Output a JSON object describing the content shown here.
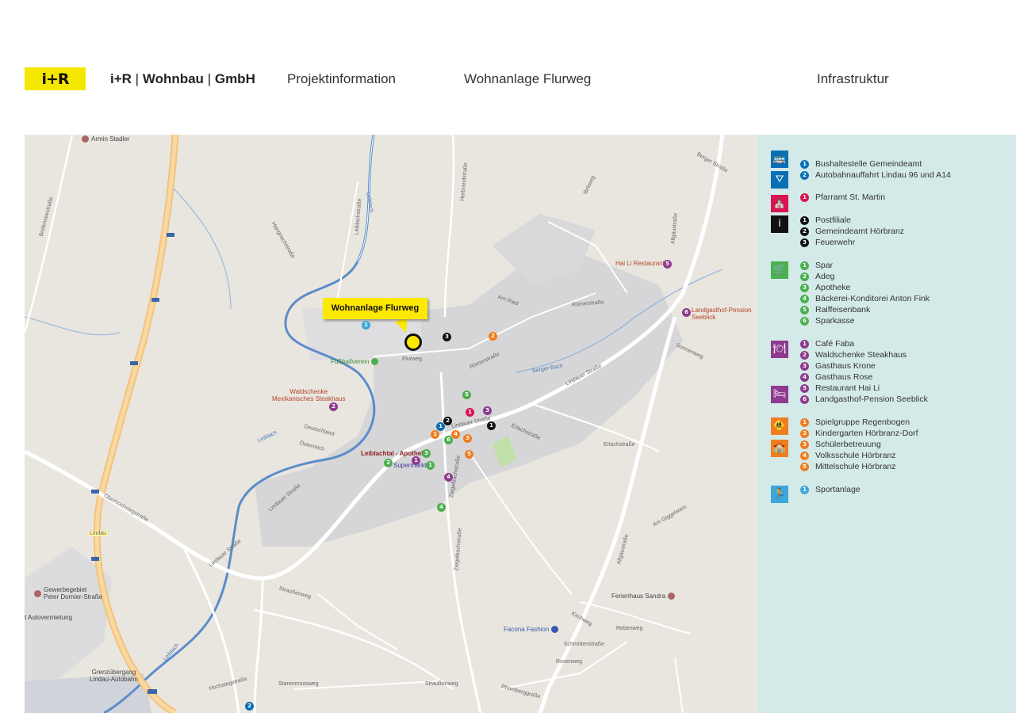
{
  "header": {
    "logo": "i+R",
    "company_name": "i+R",
    "company_wohnbau": "Wohnbau",
    "company_gmbh": "GmbH",
    "sep": "|",
    "projekt": "Projektinformation",
    "wohnanlage": "Wohnanlage Flurweg",
    "infrastruktur": "Infrastruktur"
  },
  "map": {
    "project_label": "Wohnanlage Flurweg",
    "places": {
      "armin_stadler": "Armin Stadler",
      "hai_li": "Hai Li Restaurant",
      "seeblick_1": "Landgasthof-Pension",
      "seeblick_2": "Seeblick",
      "fussballverein": "Fußballverein",
      "waldschenke_1": "Waldschenke",
      "waldschenke_2": "Mexikanisches Steakhaus",
      "apotheke": "Leiblachtal - Apotheke",
      "supermarkt": "Supermarkt",
      "gewerbe_1": "Gewerbegebiet",
      "gewerbe_2": "Peter Dornier-Straße",
      "autovermietung": "t Autovermietung",
      "grenz_1": "Grenzübergang",
      "grenz_2": "Lindau-Autobahn",
      "ferienhaus": "Ferienhaus Sandra",
      "facona": "Facona Fashion"
    },
    "streets": {
      "flurweg": "Flurweg",
      "roemerstr": "Römerstraße",
      "roemerstr2": "Römerstraße",
      "lindauer": "Lindauer Straße",
      "lindauer2": "Lindauer Straße",
      "lindauer3": "Lindauer Straße",
      "lindauer4": "Lindauer Straße",
      "berger_bach": "Berger Bach",
      "berger_str": "Berger Straße",
      "allgaeu": "Allgäustraße",
      "allgaeu2": "Allgäustraße",
      "strassenweg": "Straußenweg",
      "strassenweg2": "Straußenweg",
      "starenmoos": "Starenmoosweg",
      "hochsteg": "Hochstegstraße",
      "oberhochsteg": "Oberhochstegstraße",
      "leiblach": "Leiblach",
      "leiblach2": "Leiblach",
      "leiblach3": "Leiblach",
      "kirchweg": "Kirchweg",
      "rebenweg": "Rebenweg",
      "erlachstr": "Erlachstraße",
      "erlachstr2": "Erlachstraße",
      "sonnenweg": "Sonnenweg",
      "ziegelbach": "Ziegelbachstraße",
      "ziegelbach2": "Ziegelbachstraße",
      "herbrand": "Herbrandstraße",
      "bodensee": "Bodenseestraße",
      "hangnach": "Hangnachstraße",
      "am_ried": "Am Ried",
      "schmittenstr": "Schmittenstraße",
      "rosenweg": "Rosenweg",
      "birkweg": "Birkweg",
      "deutschland": "Deutschland",
      "oesterreich": "Österreich",
      "lindau": "Lindau",
      "am_giggelstein": "Am Giggelstein",
      "leiblachstr": "Leiblachstraße",
      "rheinberg": "Rhomberggraße"
    }
  },
  "legend": {
    "groups": [
      {
        "icon": "bus-icon",
        "color": "#0a6eb4",
        "glyph": "🚌",
        "items": []
      },
      {
        "icon": "highway-icon",
        "color": "#0a6eb4",
        "glyph": "⛛",
        "items": []
      },
      {
        "icon": "church-icon",
        "color": "#d9144f",
        "glyph": "⛪",
        "items": []
      },
      {
        "icon": "info-icon",
        "color": "#111111",
        "glyph": "i",
        "items": []
      },
      {
        "icon": "cart-icon",
        "color": "#4caf50",
        "glyph": "🛒",
        "items": []
      },
      {
        "icon": "restaurant-icon",
        "color": "#8e3a8e",
        "glyph": "🍽",
        "items": []
      },
      {
        "icon": "bed-icon",
        "color": "#8e3a8e",
        "glyph": "🛏",
        "items": []
      },
      {
        "icon": "child-icon",
        "color": "#ef7d20",
        "glyph": "🚸",
        "items": []
      },
      {
        "icon": "school-icon",
        "color": "#ef7d20",
        "glyph": "🏫",
        "items": []
      },
      {
        "icon": "sport-icon",
        "color": "#3ea6d9",
        "glyph": "🏃",
        "items": []
      }
    ],
    "items": [
      {
        "n": "1",
        "color": "#0a6eb4",
        "label": "Bushaltestelle Gemeindeamt"
      },
      {
        "n": "2",
        "color": "#0a6eb4",
        "label": "Autobahnauffahrt Lindau 96 und A14"
      },
      {
        "n": "1",
        "color": "#d9144f",
        "label": "Pfarramt St. Martin"
      },
      {
        "n": "1",
        "color": "#111111",
        "label": "Postfiliale"
      },
      {
        "n": "2",
        "color": "#111111",
        "label": "Gemeindeamt Hörbranz"
      },
      {
        "n": "3",
        "color": "#111111",
        "label": "Feuerwehr"
      },
      {
        "n": "1",
        "color": "#4caf50",
        "label": "Spar"
      },
      {
        "n": "2",
        "color": "#4caf50",
        "label": "Adeg"
      },
      {
        "n": "3",
        "color": "#4caf50",
        "label": "Apotheke"
      },
      {
        "n": "4",
        "color": "#4caf50",
        "label": "Bäckerei-Konditorei Anton Fink"
      },
      {
        "n": "5",
        "color": "#4caf50",
        "label": "Raiffeisenbank"
      },
      {
        "n": "6",
        "color": "#4caf50",
        "label": "Sparkasse"
      },
      {
        "n": "1",
        "color": "#8e3a8e",
        "label": "Café Faba"
      },
      {
        "n": "2",
        "color": "#8e3a8e",
        "label": "Waldschenke Steakhaus"
      },
      {
        "n": "3",
        "color": "#8e3a8e",
        "label": "Gasthaus Krone"
      },
      {
        "n": "4",
        "color": "#8e3a8e",
        "label": "Gasthaus Rose"
      },
      {
        "n": "5",
        "color": "#8e3a8e",
        "label": "Restaurant Hai Li"
      },
      {
        "n": "6",
        "color": "#8e3a8e",
        "label": "Landgasthof-Pension Seeblick"
      },
      {
        "n": "1",
        "color": "#ef7d20",
        "label": "Spielgruppe Regenbogen"
      },
      {
        "n": "2",
        "color": "#ef7d20",
        "label": "Kindergarten Hörbranz-Dorf"
      },
      {
        "n": "3",
        "color": "#ef7d20",
        "label": "Schülerbetreuung"
      },
      {
        "n": "4",
        "color": "#ef7d20",
        "label": "Volksschule Hörbranz"
      },
      {
        "n": "5",
        "color": "#ef7d20",
        "label": "Mittelschule Hörbranz"
      },
      {
        "n": "1",
        "color": "#3ea6d9",
        "label": "Sportanlage"
      }
    ]
  },
  "markers": [
    {
      "n": "1",
      "color": "#3ea6d9"
    },
    {
      "n": "3",
      "color": "#111111"
    },
    {
      "n": "2",
      "color": "#ef7d20"
    },
    {
      "n": "5",
      "color": "#8e3a8e"
    },
    {
      "n": "6",
      "color": "#8e3a8e"
    },
    {
      "n": "2",
      "color": "#8e3a8e"
    },
    {
      "n": "5",
      "color": "#4caf50"
    },
    {
      "n": "1",
      "color": "#d9144f"
    },
    {
      "n": "3",
      "color": "#8e3a8e"
    },
    {
      "n": "2",
      "color": "#111111"
    },
    {
      "n": "1",
      "color": "#0a6eb4"
    },
    {
      "n": "1",
      "color": "#111111"
    },
    {
      "n": "1",
      "color": "#ef7d20"
    },
    {
      "n": "4",
      "color": "#ef7d20"
    },
    {
      "n": "6",
      "color": "#4caf50"
    },
    {
      "n": "3",
      "color": "#ef7d20"
    },
    {
      "n": "5",
      "color": "#ef7d20"
    },
    {
      "n": "3",
      "color": "#4caf50"
    },
    {
      "n": "1",
      "color": "#8e3a8e"
    },
    {
      "n": "2",
      "color": "#4caf50"
    },
    {
      "n": "1",
      "color": "#4caf50"
    },
    {
      "n": "4",
      "color": "#8e3a8e"
    },
    {
      "n": "4",
      "color": "#4caf50"
    },
    {
      "n": "2",
      "color": "#0a6eb4"
    }
  ]
}
